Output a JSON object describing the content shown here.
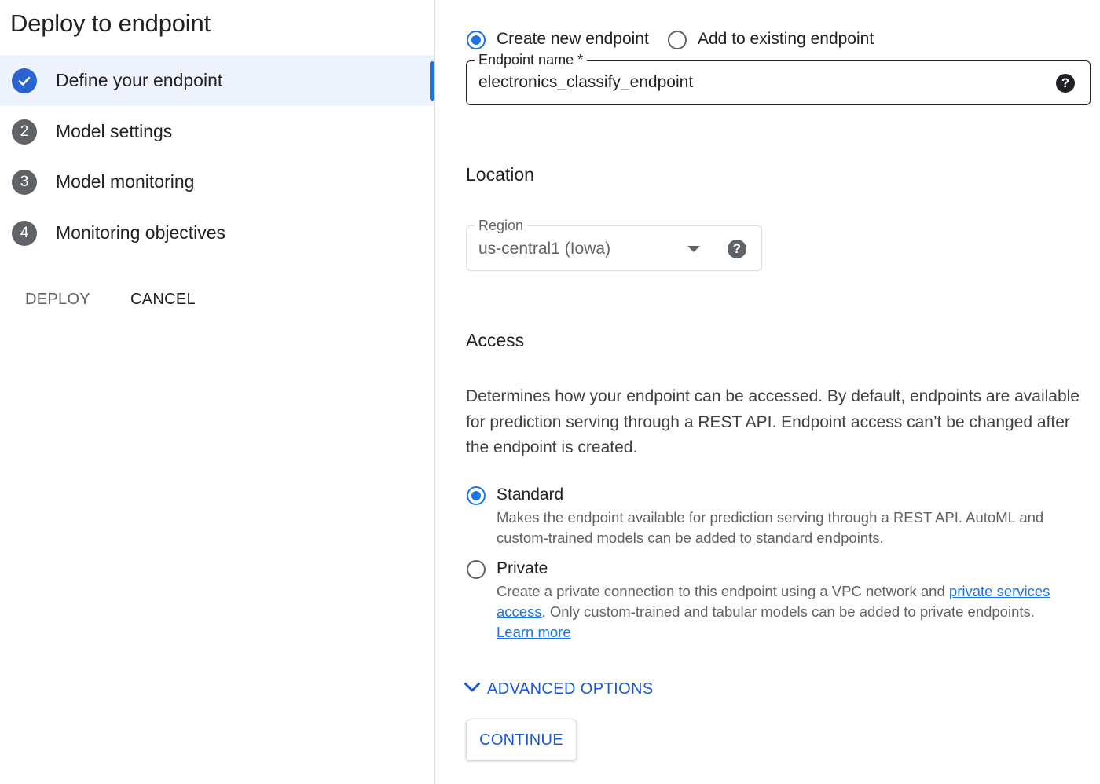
{
  "stepper": {
    "title": "Deploy to endpoint",
    "steps": [
      {
        "number": "",
        "label": "Define your endpoint",
        "state": "completed-active"
      },
      {
        "number": "2",
        "label": "Model settings",
        "state": "pending"
      },
      {
        "number": "3",
        "label": "Model monitoring",
        "state": "pending"
      },
      {
        "number": "4",
        "label": "Monitoring objectives",
        "state": "pending"
      }
    ],
    "deploy_label": "DEPLOY",
    "cancel_label": "CANCEL"
  },
  "endpoint_mode": {
    "create_new_label": "Create new endpoint",
    "add_existing_label": "Add to existing endpoint",
    "selected": "Create new endpoint"
  },
  "endpoint_name": {
    "label": "Endpoint name *",
    "value": "electronics_classify_endpoint",
    "help_icon": "question-circle-icon"
  },
  "location": {
    "heading": "Location",
    "region_label": "Region",
    "region_value": "us-central1 (Iowa)",
    "help_icon": "question-circle-icon"
  },
  "access": {
    "heading": "Access",
    "description": "Determines how your endpoint can be accessed. By default, endpoints are available for prediction serving through a REST API. Endpoint access can’t be changed after the endpoint is created.",
    "selected": "Standard",
    "standard": {
      "label": "Standard",
      "description": "Makes the endpoint available for prediction serving through a REST API. AutoML and custom-trained models can be added to standard endpoints."
    },
    "private": {
      "label": "Private",
      "description_before": "Create a private connection to this endpoint using a VPC network and ",
      "link_text": "private services access",
      "description_after": ". Only custom-trained and tabular models can be added to private endpoints.",
      "learn_more": "Learn more"
    }
  },
  "advanced_options_label": "ADVANCED OPTIONS",
  "continue_label": "CONTINUE",
  "colors": {
    "accent": "#1a73e8",
    "active_step_bg": "#eef3fd",
    "completed_step": "#2a63cf"
  }
}
